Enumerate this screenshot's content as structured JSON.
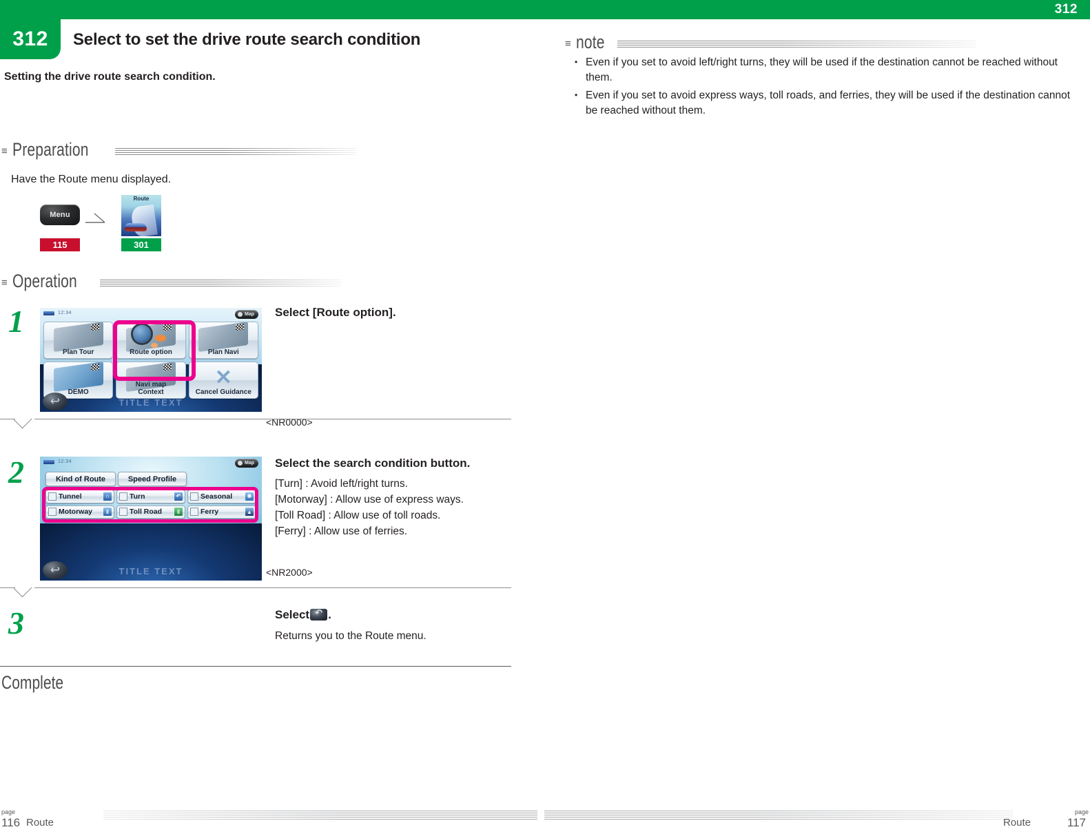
{
  "header": {
    "chapter_number": "312",
    "corner_page": "312",
    "title": "Select to set the drive route search condition",
    "subtitle": "Setting the drive route search condition.",
    "accent_green": "#00a04b"
  },
  "note": {
    "heading": "note",
    "glyph": "≡",
    "items": [
      "Even if you set to avoid left/right turns, they will be used if the destination cannot be reached without them.",
      "Even if you set to avoid express ways, toll roads, and ferries, they will be used if the destination cannot be reached without them."
    ]
  },
  "preparation": {
    "heading": "Preparation",
    "glyph": "≡",
    "text": "Have the Route menu displayed.",
    "flow": {
      "menu_key_label": "Menu",
      "menu_ref": "115",
      "menu_ref_color": "#c8102e",
      "route_thumb_label": "Route",
      "route_ref": "301",
      "route_ref_color": "#00a04b"
    }
  },
  "operation": {
    "heading": "Operation",
    "glyph": "≡",
    "steps": [
      {
        "number": "1",
        "title": "Select [Route option].",
        "body": "",
        "code": "<NR0000>",
        "screen": {
          "clock": "12:34",
          "map_button": "Map",
          "title_text": "TITLE TEXT",
          "tiles": [
            "Plan Tour",
            "Route option",
            "Plan Navi",
            "DEMO",
            "Navi map\nContext",
            "Cancel Guidance"
          ],
          "highlighted_tile": "Route option",
          "highlight_color": "#ec008c"
        }
      },
      {
        "number": "2",
        "title": "Select the search condition button.",
        "body": "[Turn] : Avoid left/right turns.\n[Motorway] : Allow use of express ways.\n[Toll Road] : Allow use of toll roads.\n[Ferry] : Allow use of ferries.",
        "code": "<NR2000>",
        "screen": {
          "clock": "12:34",
          "map_button": "Map",
          "title_text": "TITLE TEXT",
          "top_buttons": [
            "Kind of Route",
            "Speed Profile"
          ],
          "condition_buttons": [
            "Tunnel",
            "Turn",
            "Seasonal",
            "Motorway",
            "Toll Road",
            "Ferry"
          ],
          "highlight_color": "#ec008c"
        }
      },
      {
        "number": "3",
        "title_prefix": "Select",
        "title_suffix": ".",
        "body": "Returns you to the Route menu.",
        "code": ""
      }
    ]
  },
  "complete": {
    "label": "Complete"
  },
  "footer": {
    "left": {
      "page_label": "page",
      "page_number": "116",
      "section": "Route"
    },
    "right": {
      "page_label": "page",
      "page_number": "117",
      "section": "Route"
    }
  }
}
